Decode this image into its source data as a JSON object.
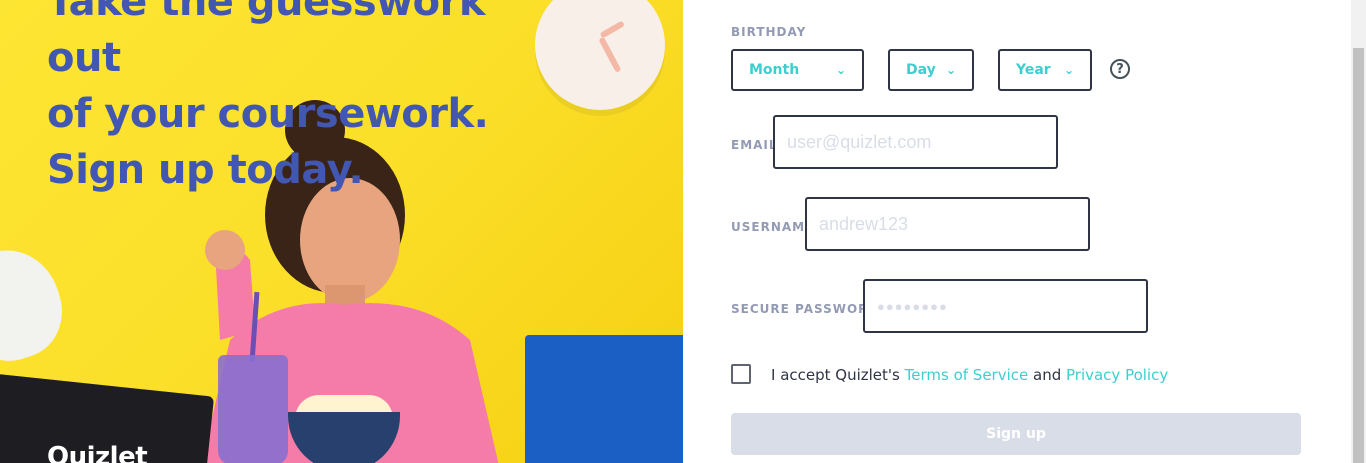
{
  "hero": {
    "headline_lines": [
      "Take the guesswork out",
      "of your coursework.",
      "Sign up today."
    ],
    "logo": "Quizlet"
  },
  "form": {
    "birthday": {
      "label": "BIRTHDAY",
      "month": "Month",
      "day": "Day",
      "year": "Year",
      "help": "?"
    },
    "email": {
      "label": "EMAIL",
      "placeholder": "user@quizlet.com"
    },
    "username": {
      "label": "USERNAME",
      "placeholder": "andrew123"
    },
    "password": {
      "label": "SECURE PASSWORD",
      "placeholder": "●●●●●●●●"
    },
    "terms": {
      "prefix": "I accept Quizlet's ",
      "tos": "Terms of Service",
      "and": " and ",
      "privacy": "Privacy Policy"
    },
    "signup_label": "Sign up"
  },
  "colors": {
    "brand_blue": "#4257b2",
    "teal": "#3ccfcf",
    "hero_yellow": "#fde533",
    "disabled_button": "#d9dde8",
    "border_dark": "#303545"
  },
  "icons": {
    "chevron": "chevron-down-icon",
    "help": "help-circle-icon"
  }
}
